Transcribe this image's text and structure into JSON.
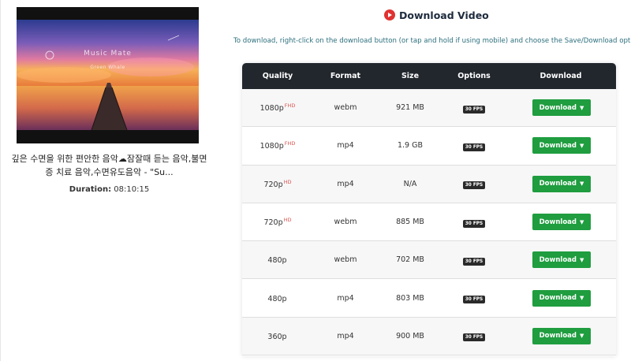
{
  "video": {
    "thumbnail_title": "Music Mate",
    "thumbnail_subtitle": "Green Whale",
    "title": "깊은 수면을 위한 편안한 음악☁잠잘때 듣는 음악,불면증 치료 음악,수면유도음악 - \"Su...",
    "duration_label": "Duration:",
    "duration_value": "08:10:15"
  },
  "header": {
    "title": "Download Video",
    "icon": "play-icon",
    "instructions": "To download, right-click on the download button (or tap and hold if using mobile) and choose the Save/Download option."
  },
  "table": {
    "columns": [
      "Quality",
      "Format",
      "Size",
      "Options",
      "Download"
    ],
    "rows": [
      {
        "quality": "1080p",
        "badge": "FHD",
        "format": "webm",
        "size": "921 MB",
        "fps": "30 FPS",
        "button": "Download"
      },
      {
        "quality": "1080p",
        "badge": "FHD",
        "format": "mp4",
        "size": "1.9 GB",
        "fps": "30 FPS",
        "button": "Download"
      },
      {
        "quality": "720p",
        "badge": "HD",
        "format": "mp4",
        "size": "N/A",
        "fps": "30 FPS",
        "button": "Download"
      },
      {
        "quality": "720p",
        "badge": "HD",
        "format": "webm",
        "size": "885 MB",
        "fps": "30 FPS",
        "button": "Download"
      },
      {
        "quality": "480p",
        "badge": "",
        "format": "webm",
        "size": "702 MB",
        "fps": "30 FPS",
        "button": "Download"
      },
      {
        "quality": "480p",
        "badge": "",
        "format": "mp4",
        "size": "803 MB",
        "fps": "30 FPS",
        "button": "Download"
      },
      {
        "quality": "360p",
        "badge": "",
        "format": "mp4",
        "size": "900 MB",
        "fps": "30 FPS",
        "button": "Download"
      }
    ]
  },
  "colors": {
    "download_button": "#1f9d3f",
    "table_header": "#22272e",
    "play_icon": "#e03232",
    "badge": "#d9534f",
    "instructions_text": "#2c6f7d"
  }
}
